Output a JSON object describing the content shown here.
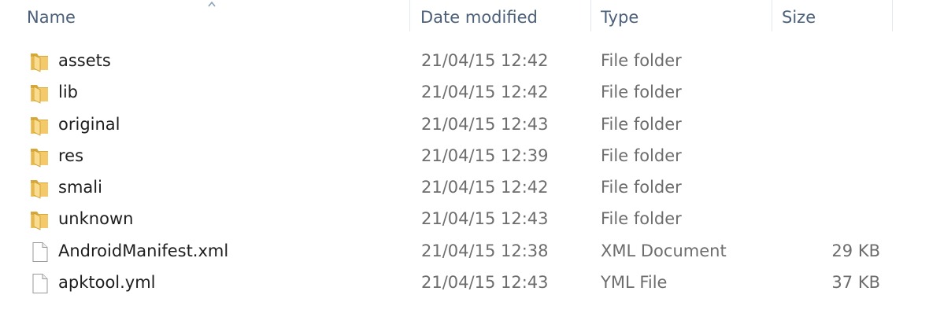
{
  "columns": {
    "name": "Name",
    "date_modified": "Date modified",
    "type": "Type",
    "size": "Size"
  },
  "sort": {
    "column": "name",
    "icon": "sort-ascending-icon"
  },
  "files": [
    {
      "name": "assets",
      "date": "21/04/15 12:42",
      "type": "File folder",
      "size": "",
      "icon": "folder-icon"
    },
    {
      "name": "lib",
      "date": "21/04/15 12:42",
      "type": "File folder",
      "size": "",
      "icon": "folder-icon"
    },
    {
      "name": "original",
      "date": "21/04/15 12:43",
      "type": "File folder",
      "size": "",
      "icon": "folder-icon"
    },
    {
      "name": "res",
      "date": "21/04/15 12:39",
      "type": "File folder",
      "size": "",
      "icon": "folder-icon"
    },
    {
      "name": "smali",
      "date": "21/04/15 12:42",
      "type": "File folder",
      "size": "",
      "icon": "folder-icon"
    },
    {
      "name": "unknown",
      "date": "21/04/15 12:43",
      "type": "File folder",
      "size": "",
      "icon": "folder-icon"
    },
    {
      "name": "AndroidManifest.xml",
      "date": "21/04/15 12:38",
      "type": "XML Document",
      "size": "29 KB",
      "icon": "document-icon"
    },
    {
      "name": "apktool.yml",
      "date": "21/04/15 12:43",
      "type": "YML File",
      "size": "37 KB",
      "icon": "document-icon"
    }
  ],
  "colors": {
    "header_text": "#4c607a",
    "detail_text": "#6d6d6d",
    "folder_light": "#f7d57c",
    "folder_dark": "#d7a93a"
  }
}
